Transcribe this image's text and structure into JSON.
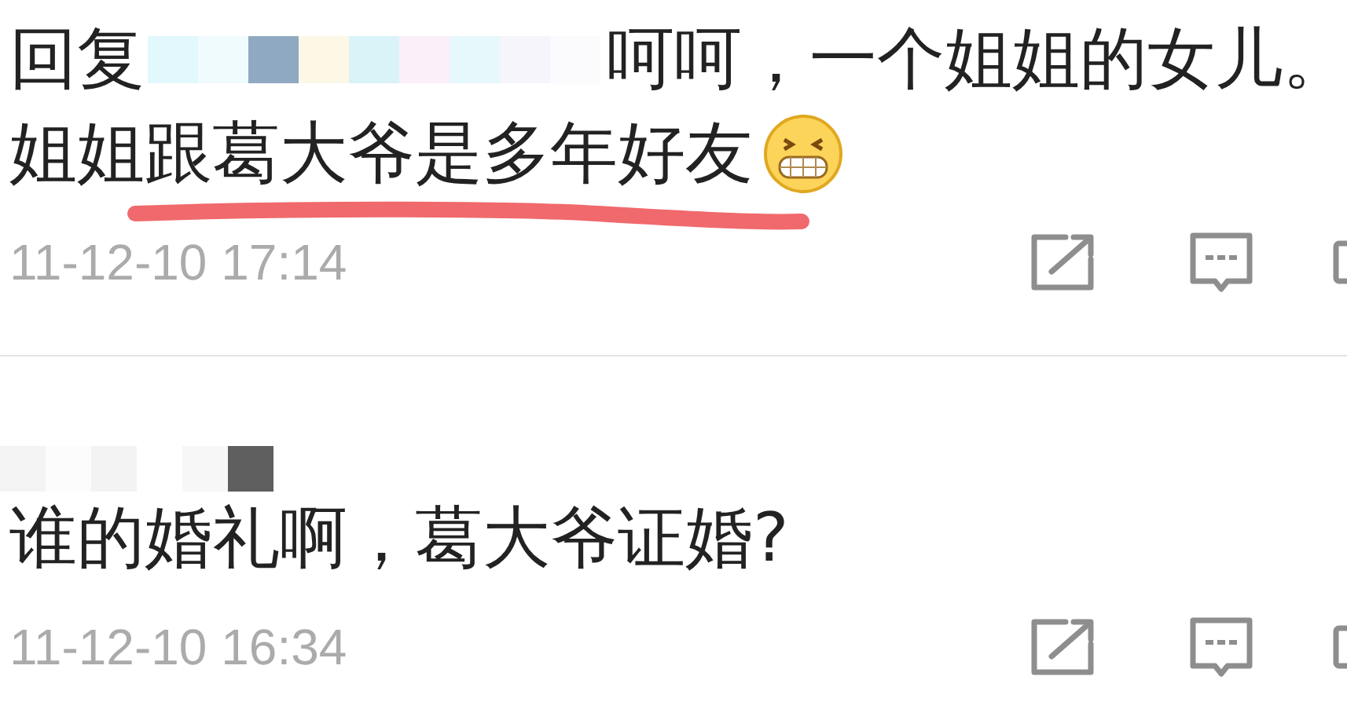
{
  "comments": [
    {
      "reply_prefix": "回复",
      "lines": [
        "呵呵，一个姐姐的女儿。",
        "姐姐跟葛大爷是多年好友"
      ],
      "emoji": true,
      "underlined": true,
      "time": "11-12-10 17:14"
    },
    {
      "lines": [
        "谁的婚礼啊，葛大爷证婚?"
      ],
      "emoji": false,
      "underlined": false,
      "time": "11-12-10 16:34"
    }
  ]
}
